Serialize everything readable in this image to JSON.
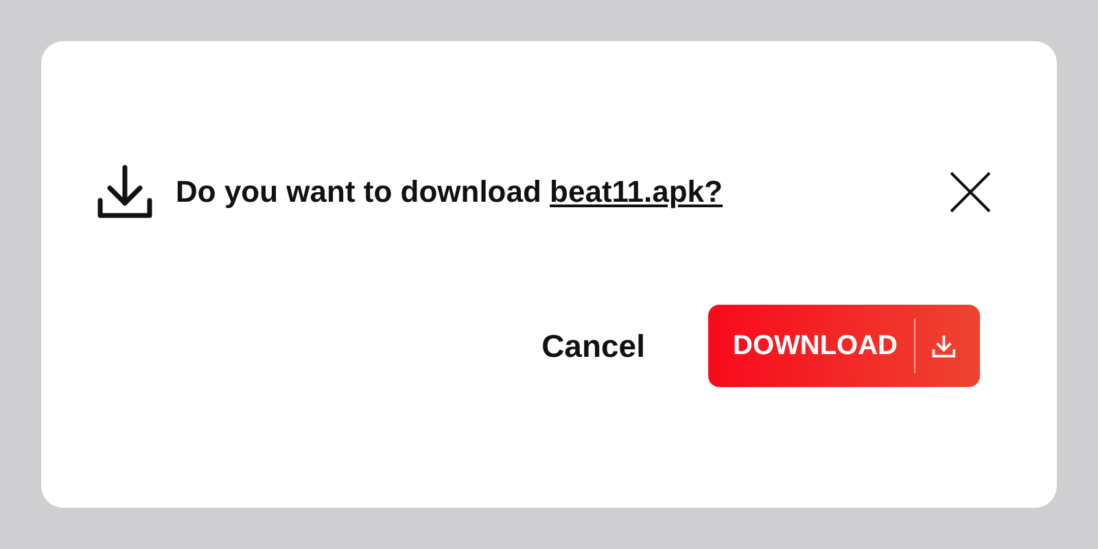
{
  "dialog": {
    "message": "Do you want to download",
    "file_link": "beat11.apk?"
  },
  "buttons": [
    {
      "kind": "text",
      "label": "Cancel"
    },
    {
      "kind": "primary",
      "label": "DOWNLOAD"
    }
  ]
}
